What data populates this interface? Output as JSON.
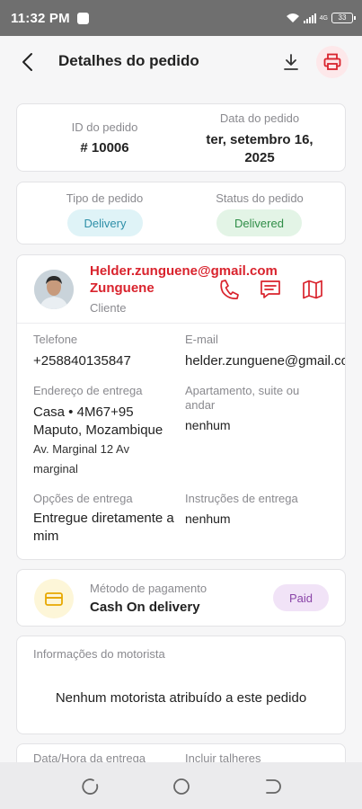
{
  "status_bar": {
    "time": "11:32 PM",
    "network": "4G",
    "battery": "33"
  },
  "header": {
    "title": "Detalhes do pedido",
    "icons": [
      "back-arrow-icon",
      "download-icon",
      "printer-icon"
    ],
    "print_color": "#d9232d"
  },
  "order": {
    "id_label": "ID do pedido",
    "id_value": "# 10006",
    "date_label": "Data do pedido",
    "date_value": "ter, setembro 16, 2025",
    "type_label": "Tipo de pedido",
    "type_value": "Delivery",
    "status_label": "Status do pedido",
    "status_value": "Delivered"
  },
  "customer": {
    "email_name": "Helder.zunguene@gmail.com",
    "name": "Zunguene",
    "role": "Cliente",
    "actions": [
      "phone-icon",
      "message-icon",
      "map-icon"
    ],
    "accent": "#d9232d",
    "phone_label": "Telefone",
    "phone": "+258840135847",
    "email_label": "E-mail",
    "email": "helder.zunguene@gmail.com",
    "address_label": "Endereço de entrega",
    "address_line1": "Casa • 4M67+95",
    "address_line2": "Maputo, Mozambique",
    "address_line3": "Av. Marginal 12 Av",
    "address_line4": "marginal",
    "apartment_label": "Apartamento, suite ou andar",
    "apartment": "nenhum",
    "delivery_options_label": "Opções de entrega",
    "delivery_options": "Entregue diretamente a mim",
    "instructions_label": "Instruções de entrega",
    "instructions": "nenhum"
  },
  "payment": {
    "label": "Método de pagamento",
    "method": "Cash On delivery",
    "status": "Paid"
  },
  "driver": {
    "label": "Informações do motorista",
    "message": "Nenhum motorista atribuído a este pedido"
  },
  "extra": {
    "datetime_label": "Data/Hora da entrega",
    "cutlery_label": "Incluir talheres"
  },
  "nav_bar": {
    "buttons": [
      "recent-apps-icon",
      "home-icon",
      "back-icon"
    ]
  }
}
